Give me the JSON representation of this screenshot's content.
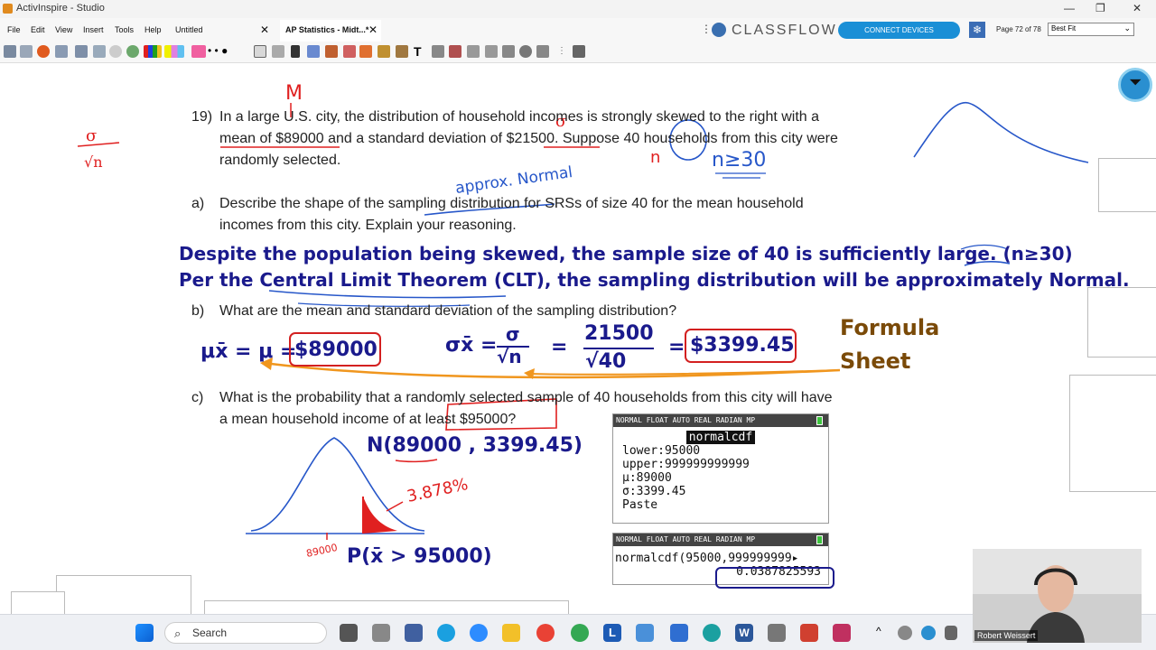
{
  "window": {
    "title": "ActivInspire - Studio",
    "controls": [
      "—",
      "❐",
      "✕"
    ]
  },
  "menu": [
    "File",
    "Edit",
    "View",
    "Insert",
    "Tools",
    "Help"
  ],
  "tabs": [
    {
      "label": "Untitled",
      "close": "✕"
    },
    {
      "label": "AP Statistics - Midt...*",
      "close": "✕"
    }
  ],
  "classflow": {
    "logo_text": "CLASSFLOW",
    "connect_label": "CONNECT DEVICES",
    "page_indicator": "Page 72 of 78",
    "zoom": "Best Fit"
  },
  "question19": {
    "num": "19)",
    "line1": "In a large U.S. city, the distribution of household incomes is strongly skewed to the right with a",
    "line2": "mean of $89000 and a standard deviation of $21500. Suppose 40 households from this city were",
    "line3": "randomly selected."
  },
  "part_a": {
    "label": "a)",
    "line1": "Describe the shape of the sampling distribution for SRSs of size 40 for the mean household",
    "line2": "incomes from this city. Explain your reasoning.",
    "answer1": "Despite the population being skewed, the sample size of 40 is sufficiently large. (n≥30)",
    "answer2": "Per the Central Limit Theorem (CLT), the sampling distribution will be approximately Normal."
  },
  "part_b": {
    "label": "b)",
    "text": "What are the mean and standard deviation of the sampling distribution?",
    "mu_lhs": "μx̄ = μ =",
    "mu_val": "$89000",
    "sigma_lhs": "σx̄ =",
    "sigma_frac_num": "σ",
    "sigma_frac_den": "√n",
    "eq": "=",
    "num_frac_num": "21500",
    "num_frac_den": "√40",
    "eq2": "=",
    "sigma_val": "$3399.45",
    "formula_sheet_1": "Formula",
    "formula_sheet_2": "Sheet"
  },
  "part_c": {
    "label": "c)",
    "line1": "What is the probability that a randomly selected sample of 40 households from this city will have",
    "line2": "a mean household income of at least $95000?",
    "normal_model": "N(89000 , 3399.45)",
    "prob_expr": "P(x̄ > 95000)"
  },
  "handwriting": {
    "M": "M",
    "sigma_over_root_n": "σ/√n",
    "n_mark": "n",
    "n_ge_30": "n≥30",
    "approx_normal": "approx. Normal",
    "pct": "3.878%",
    "mean_label": "89000",
    "large": "large"
  },
  "calc1": {
    "header": "NORMAL FLOAT AUTO REAL RADIAN MP",
    "title": "normalcdf",
    "lower": "lower:95000",
    "upper": "upper:999999999999",
    "mu": "μ:89000",
    "sigma": "σ:3399.45",
    "paste": "Paste"
  },
  "calc2": {
    "header": "NORMAL FLOAT AUTO REAL RADIAN MP",
    "cmd": "normalcdf(95000,999999999▸",
    "result": "0.0387825593"
  },
  "taskbar": {
    "search": "Search"
  },
  "webcam": {
    "name": "Robert Weissert"
  },
  "colors": {
    "answer": "#1a1a8c",
    "box": "#d32020",
    "arrow": "#f0961e",
    "ink_blue": "#2757c9",
    "ink_red": "#e02020"
  }
}
